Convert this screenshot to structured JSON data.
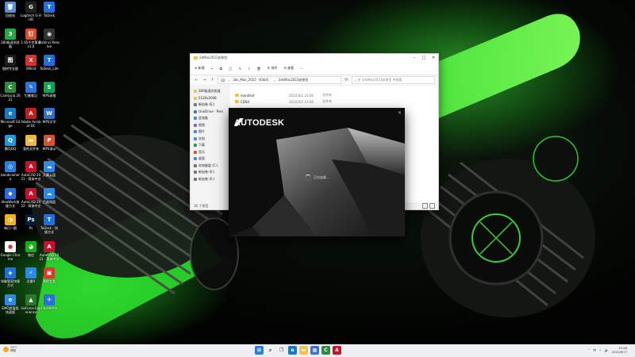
{
  "desktop_icons": [
    {
      "label": "回收站",
      "color": "#5b8fd6",
      "glyph": "🗑"
    },
    {
      "label": "Logitech G HUB",
      "color": "#222222",
      "glyph": "G"
    },
    {
      "label": "ToDesk",
      "color": "#1f6fe0",
      "glyph": "T"
    },
    {
      "label": "360极速浏览器",
      "color": "#27a844",
      "glyph": "3"
    },
    {
      "label": "1.65千克第者 v1.0",
      "color": "#d84f2a",
      "glyph": "钉"
    },
    {
      "label": "DaVinci Resolve",
      "color": "#333333",
      "glyph": "◉"
    },
    {
      "label": "图拼专业版",
      "color": "#1c1c1c",
      "glyph": "图"
    },
    {
      "label": "XMind",
      "color": "#d8302d",
      "glyph": "X"
    },
    {
      "label": "ToDesk_Lite",
      "color": "#1f6fe0",
      "glyph": "T"
    },
    {
      "label": "Camtasia 2021",
      "color": "#2d8a3e",
      "glyph": "C"
    },
    {
      "label": "钉集笔记",
      "color": "#2b73d2",
      "glyph": "✎"
    },
    {
      "label": "WPS表格",
      "color": "#1a9e55",
      "glyph": "S"
    },
    {
      "label": "Microsoft Edge",
      "color": "#1479c9",
      "glyph": "e"
    },
    {
      "label": "Adobe Acrobat DC",
      "color": "#c41e1e",
      "glyph": "A"
    },
    {
      "label": "WPS文字",
      "color": "#2f6fd6",
      "glyph": "W"
    },
    {
      "label": "腾讯QQ",
      "color": "#1c9ae6",
      "glyph": "Q"
    },
    {
      "label": "我的文件夹",
      "color": "#f2b63a",
      "glyph": "▬"
    },
    {
      "label": "WPS演示",
      "color": "#d6532b",
      "glyph": "P"
    },
    {
      "label": "bandicamera",
      "color": "#2a7dd8",
      "glyph": "◎"
    },
    {
      "label": "AutoCAD 2021 - 简体中文",
      "color": "#c8102e",
      "glyph": "A"
    },
    {
      "label": "天翼云盘",
      "color": "#2a8ae6",
      "glyph": "☁"
    },
    {
      "label": "IdeaWork快捷方式",
      "color": "#2a6fdd",
      "glyph": "◆"
    },
    {
      "label": "AutoCAD 2022 - 简体中文",
      "color": "#c8102e",
      "glyph": "A"
    },
    {
      "label": "百度网盘",
      "color": "#2a8ae6",
      "glyph": "☁"
    },
    {
      "label": "每日一图",
      "color": "#f0b020",
      "glyph": "◑"
    },
    {
      "label": "Ps",
      "color": "#001e36",
      "glyph": "Ps"
    },
    {
      "label": "ToDesk - 快捷方式",
      "color": "#1f6fe0",
      "glyph": "T"
    },
    {
      "label": "Google Chrome",
      "color": "#ffffff",
      "glyph": "●"
    },
    {
      "label": "微信",
      "color": "#1aad19",
      "glyph": "◕"
    },
    {
      "label": "AutoCAD 2021 - 简体中文",
      "color": "#c8102e",
      "glyph": "A"
    },
    {
      "label": "电脑管家快捷方式",
      "color": "#1f6fe0",
      "glyph": "◈"
    },
    {
      "label": "迅雷X",
      "color": "#2a8ae6",
      "glyph": "⚡"
    },
    {
      "label": "我的五金",
      "color": "#d8382d",
      "glyph": "▣"
    },
    {
      "label": "EMO超值版 快速版",
      "color": "#2a8ae6",
      "glyph": "e"
    },
    {
      "label": "GeForce Experience",
      "color": "#2b7a2b",
      "glyph": "▲"
    },
    {
      "label": "Flash8中文",
      "color": "#2a6fdd",
      "glyph": "✈"
    }
  ],
  "explorer": {
    "title": "3dMax2023安装包",
    "toolbar": {
      "new_label": "新建",
      "sort_label": "排序",
      "view_label": "查看"
    },
    "address": {
      "segments": [
        "3D",
        "3ds_Max_2023（64bit）",
        "3dsMax2023安装包"
      ],
      "search_placeholder": "在 3dsMax2023安装包 中搜索"
    },
    "sidebar": [
      {
        "label": "360极速浏览器",
        "color": "#f2c14e"
      },
      {
        "label": "5120x2048",
        "color": "#f2c14e"
      },
      {
        "label": "新加卷 (E:)",
        "color": "#777777"
      },
      {
        "label": "OneDrive - Pers",
        "color": "#2a7dd8"
      },
      {
        "label": "此电脑",
        "color": "#3d8fe0"
      },
      {
        "label": "视频",
        "color": "#8a5cd6"
      },
      {
        "label": "图片",
        "color": "#3d8fe0"
      },
      {
        "label": "文档",
        "color": "#3d8fe0"
      },
      {
        "label": "下载",
        "color": "#2a9a4a"
      },
      {
        "label": "音乐",
        "color": "#d8582d"
      },
      {
        "label": "桌面",
        "color": "#3d8fe0"
      },
      {
        "label": "本地磁盘 (C:)",
        "color": "#777777"
      },
      {
        "label": "新加卷 (E:)",
        "color": "#777777"
      },
      {
        "label": "新加卷 (E:)",
        "color": "#777777"
      }
    ],
    "files": [
      {
        "name": "manifest",
        "date": "2022/4/2 23:08",
        "type": "文件夹"
      },
      {
        "name": "CDSX",
        "date": "2022/4/2 23:08",
        "type": "文件夹"
      }
    ],
    "status": "16 个项目"
  },
  "splash": {
    "brand": "AUTODESK",
    "loading": "正在加载..."
  },
  "taskbar": {
    "weather_temp": "34°C",
    "weather_desc": "晴朗",
    "time": "19:48",
    "date": "2022/6/17",
    "lang": "中"
  }
}
